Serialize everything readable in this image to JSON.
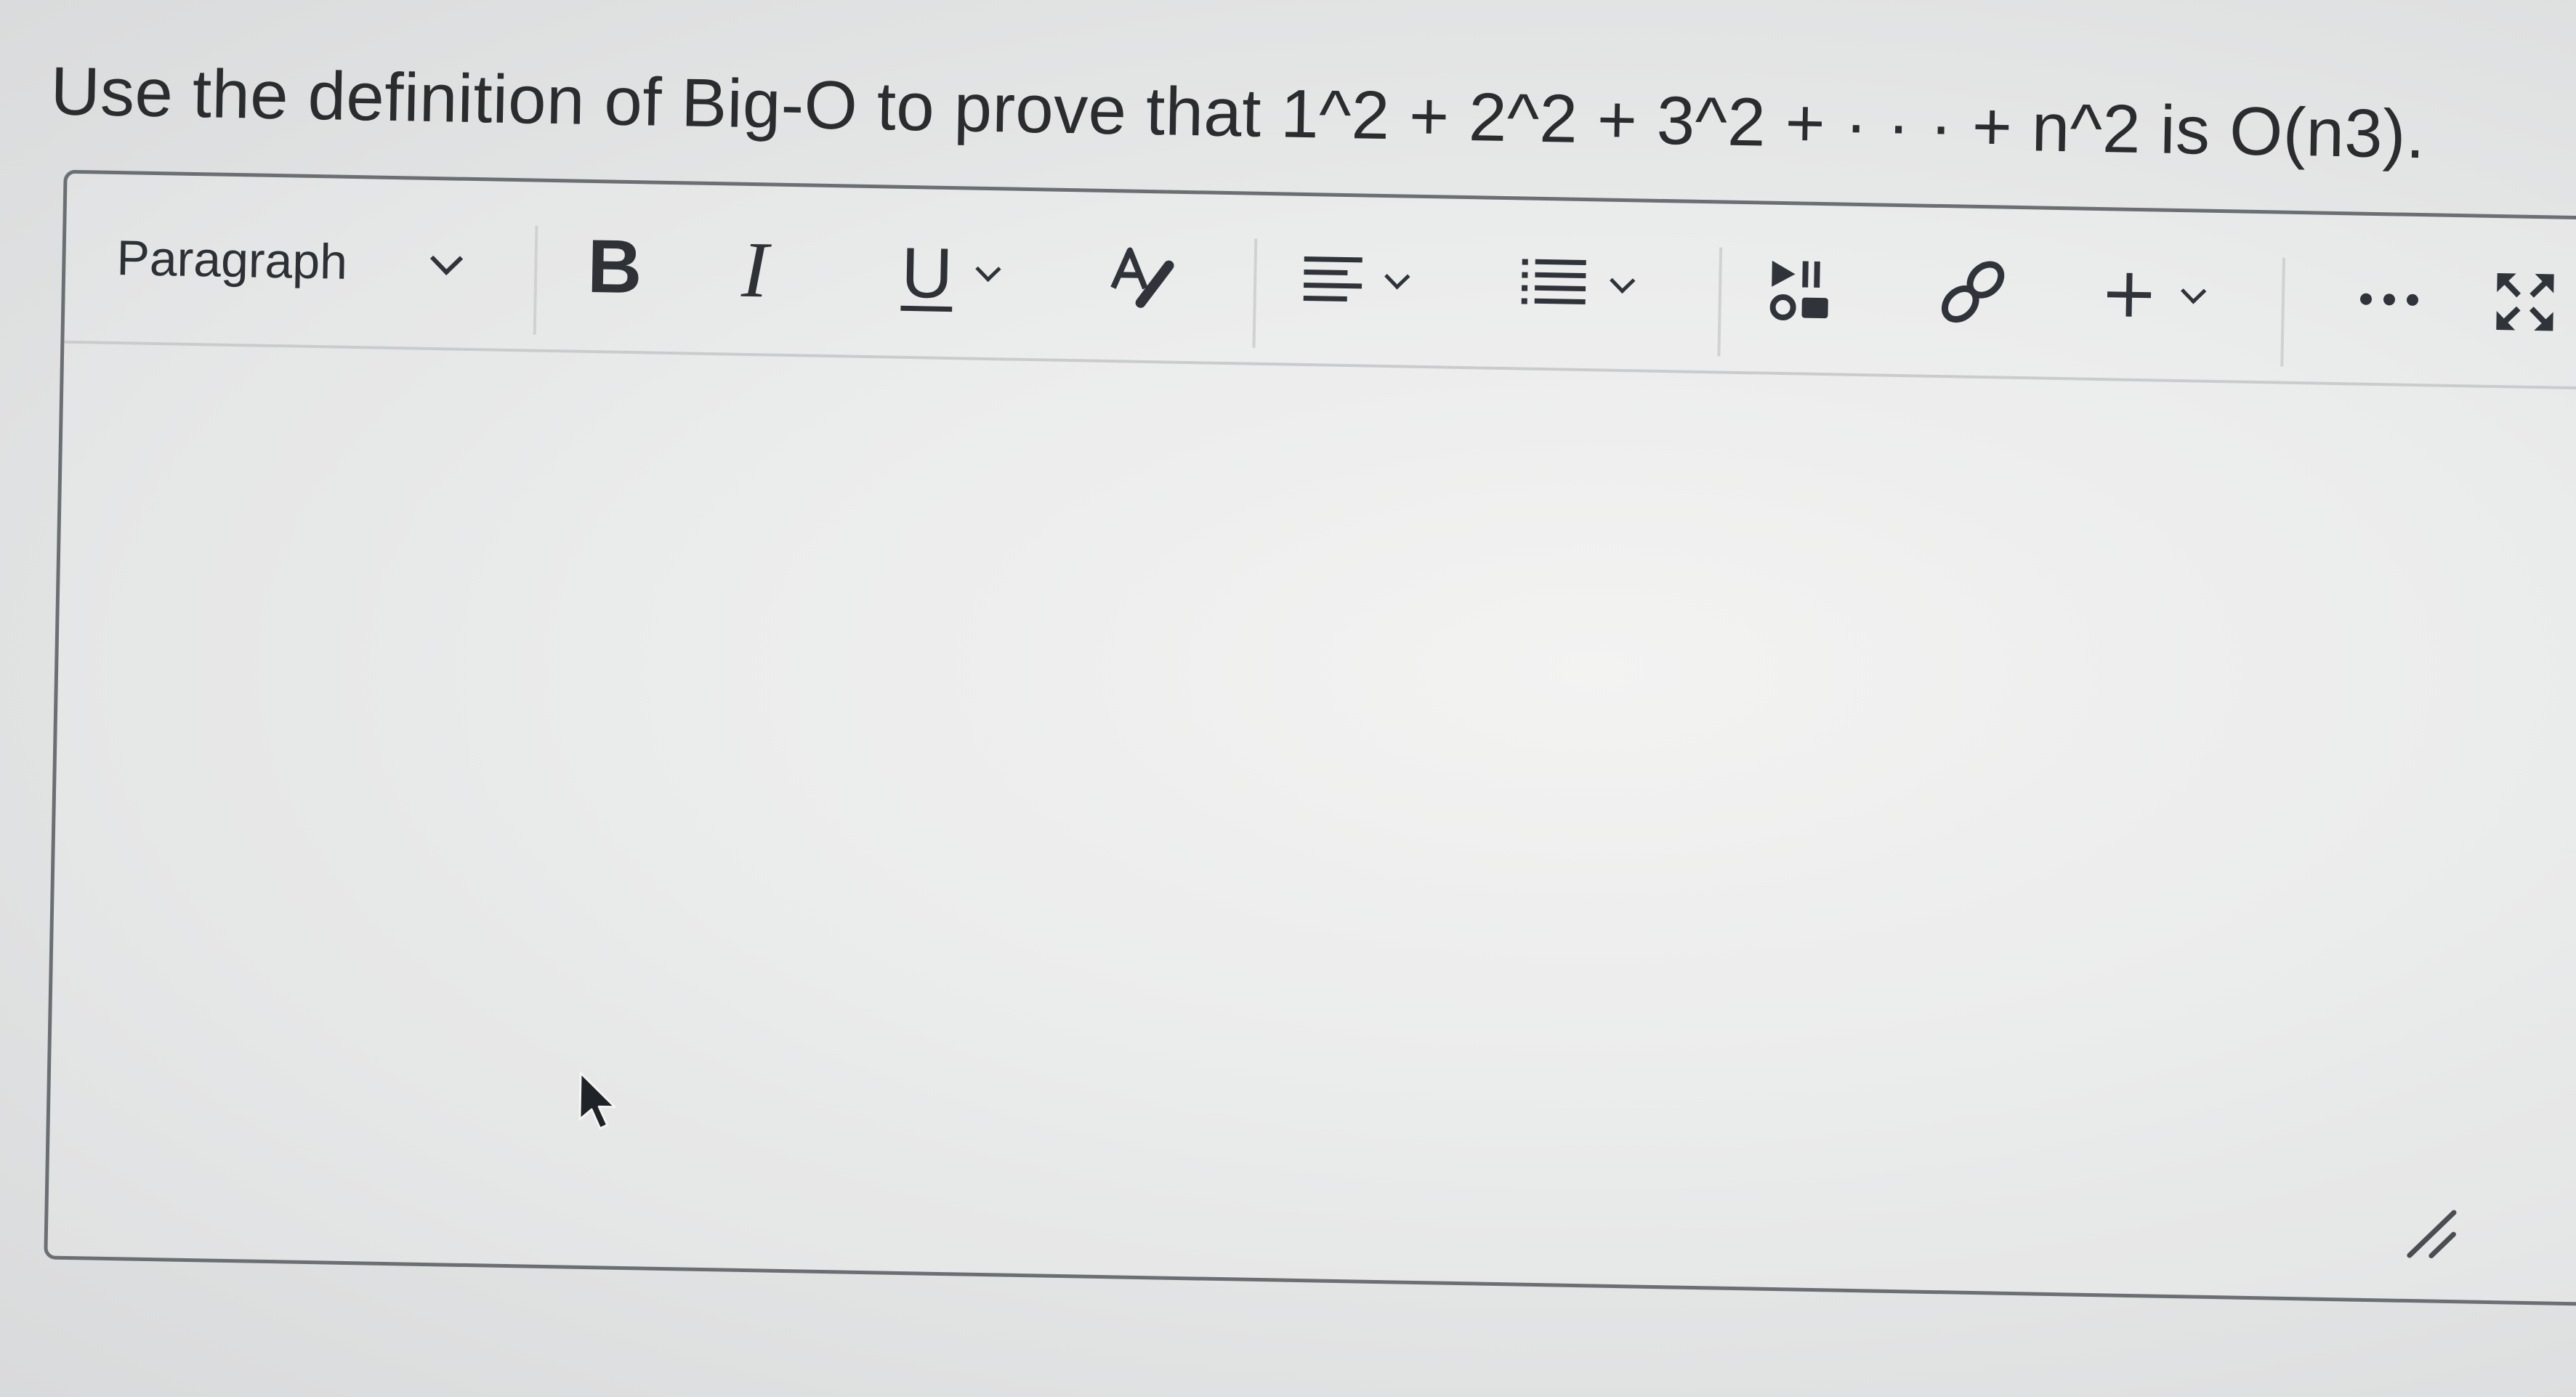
{
  "question": {
    "text": "Use the definition of Big-O to prove that 1^2 + 2^2 + 3^2 + · · · + n^2 is O(n3)."
  },
  "editor": {
    "toolbar": {
      "block_format": "Paragraph",
      "bold_label": "B",
      "italic_label": "I",
      "underline_label": "U",
      "icons": [
        "chevron-down-icon",
        "text-color-icon",
        "align-icon",
        "list-icon",
        "media-icon",
        "link-icon",
        "plus-icon",
        "more-icon",
        "fullscreen-icon",
        "resize-handle-icon",
        "mouse-cursor-icon"
      ]
    },
    "body_text": ""
  },
  "colors": {
    "text": "#2a2c2e",
    "border": "#6b6f73",
    "background": "#e6e7e7"
  }
}
